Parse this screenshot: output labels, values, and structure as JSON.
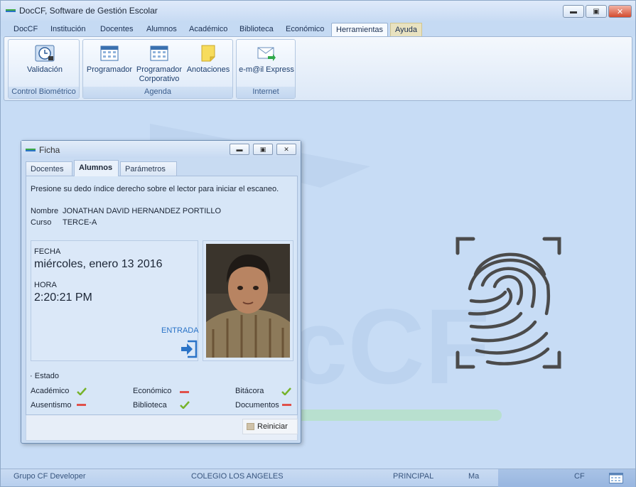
{
  "app": {
    "title": "DocCF, Software de Gestión Escolar"
  },
  "colors": {
    "accent_green": "#3ba845",
    "accent_blue": "#2a73c7",
    "status_red": "#e0514b",
    "check_green": "#76b32b"
  },
  "menu": {
    "items": [
      "DocCF",
      "Institución",
      "Docentes",
      "Alumnos",
      "Académico",
      "Biblioteca",
      "Económico",
      "Herramientas",
      "Ayuda"
    ],
    "active": "Herramientas"
  },
  "ribbon": {
    "groups": [
      {
        "label": "Control Biométrico",
        "buttons": [
          {
            "label": "Validación",
            "icon": "clock-icon"
          }
        ]
      },
      {
        "label": "Agenda",
        "buttons": [
          {
            "label": "Programador",
            "icon": "calendar-icon"
          },
          {
            "label": "Programador Corporativo",
            "line1": "Programador",
            "line2": "Corporativo",
            "icon": "calendar-icon"
          },
          {
            "label": "Anotaciones",
            "icon": "sticky-note-icon"
          }
        ]
      },
      {
        "label": "Internet",
        "buttons": [
          {
            "label": "e-m@il Express",
            "icon": "email-icon"
          }
        ]
      }
    ]
  },
  "dialog": {
    "title": "Ficha",
    "tabs": [
      "Docentes",
      "Alumnos",
      "Parámetros"
    ],
    "selected_tab": "Alumnos",
    "instruction": "Presione su dedo índice derecho sobre el lector para iniciar el escaneo.",
    "nombre_label": "Nombre",
    "nombre_value": "JONATHAN DAVID HERNANDEZ PORTILLO",
    "curso_label": "Curso",
    "curso_value": "TERCE-A",
    "fecha_label": "FECHA",
    "fecha_value": "miércoles, enero 13 2016",
    "hora_label": "HORA",
    "hora_value": "2:20:21 PM",
    "entrada_label": "ENTRADA",
    "estado_label": "Estado",
    "estado": [
      {
        "label": "Académico",
        "status": "ok"
      },
      {
        "label": "Económico",
        "status": "alert"
      },
      {
        "label": "Bitácora",
        "status": "ok"
      },
      {
        "label": "Ausentismo",
        "status": "alert"
      },
      {
        "label": "Biblioteca",
        "status": "ok"
      },
      {
        "label": "Documentos",
        "status": "alert"
      }
    ],
    "reset_label": "Reiniciar"
  },
  "statusbar": {
    "developer": "Grupo CF Developer",
    "school": "COLEGIO LOS ANGELES",
    "section": "PRINCIPAL",
    "short": "Ma",
    "code": "CF"
  }
}
